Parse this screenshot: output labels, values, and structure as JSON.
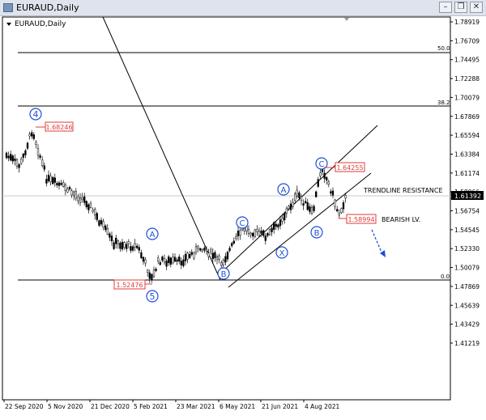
{
  "window": {
    "title": "EURAUD,Daily",
    "buttons": {
      "minimize": "–",
      "restore": "❐",
      "close": "✕"
    }
  },
  "chart": {
    "label": "EURAUD,Daily",
    "price_axis": [
      "1.78919",
      "1.76709",
      "1.74495",
      "1.72288",
      "1.70079",
      "1.67869",
      "1.65594",
      "1.63384",
      "1.61174",
      "1.58966",
      "1.56754",
      "1.54545",
      "1.52330",
      "1.50079",
      "1.47869",
      "1.45639",
      "1.43429",
      "1.41219"
    ],
    "time_axis": [
      "22 Sep 2020",
      "5 Nov 2020",
      "21 Dec 2020",
      "5 Feb 2021",
      "23 Mar 2021",
      "6 May 2021",
      "21 Jun 2021",
      "4 Aug 2021"
    ],
    "current_price": "1.61392",
    "annotations": {
      "fib_50": "50.0",
      "fib_38": "38.2",
      "fib_0": "0.0",
      "trendline_resistance": "TRENDLINE RESISTANCE",
      "bearish_lv": "BEARISH LV.",
      "level_high": "1.68246",
      "level_low": "1.52476",
      "level_c": "1.64255",
      "level_b": "1.58994"
    },
    "waves": {
      "w4": "4",
      "w5": "5",
      "a1": "A",
      "b1": "B",
      "c1": "C",
      "a2": "A",
      "x": "X",
      "c2": "C",
      "b2": "B"
    },
    "colors": {
      "candles": "#000000",
      "wave_label": "#1f4fd8",
      "price_box": "#e23b3b",
      "arrow": "#1f4fd8"
    }
  }
}
